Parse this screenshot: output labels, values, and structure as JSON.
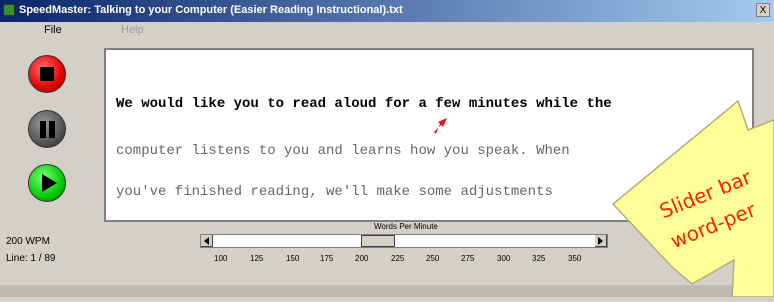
{
  "window": {
    "title": "SpeedMaster: Talking to your Computer (Easier Reading Instructional).txt",
    "control": "X"
  },
  "menu": {
    "file": "File",
    "help": "Help"
  },
  "controls": {
    "stop_icon": "stop-icon",
    "pause_icon": "pause-icon",
    "play_icon": "play-icon"
  },
  "status": {
    "wpm": "200 WPM",
    "line": "Line: 1 / 89"
  },
  "reading": {
    "line1": "We would like you to read aloud for a few minutes while the",
    "line2": "computer listens to you and learns how you speak.  When",
    "line3": "you've finished reading, we'll make some adjustments"
  },
  "slider": {
    "label": "Words Per Minute",
    "ticks": [
      "100",
      "125",
      "150",
      "175",
      "200",
      "225",
      "250",
      "275",
      "300",
      "325",
      "350"
    ],
    "selected": 200
  },
  "callout": {
    "line1": "Slider bar",
    "line2": "word-per"
  },
  "colors": {
    "stop": "#e00000",
    "pause": "#555555",
    "play": "#00cc00",
    "callout_fill": "#ffff99",
    "callout_text": "#ff2200",
    "pointer": "#ee1111"
  }
}
